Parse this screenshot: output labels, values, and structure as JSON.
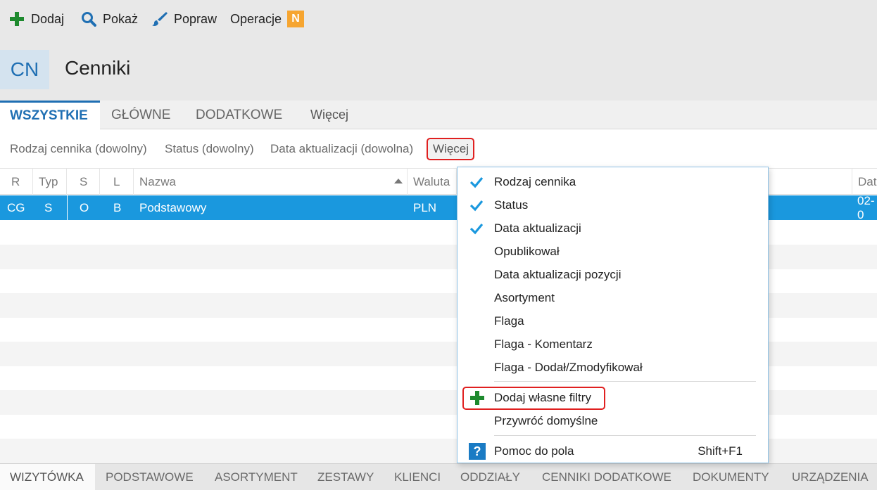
{
  "toolbar": {
    "add_label": "Dodaj",
    "show_label": "Pokaż",
    "edit_label": "Popraw",
    "operations_label": "Operacje",
    "operations_badge": "N",
    "colors": {
      "add_icon": "#1e8a2e",
      "search_icon": "#1f6fb3",
      "edit_icon": "#1f6fb3",
      "badge": "#f6a530"
    }
  },
  "header": {
    "code": "CN",
    "title": "Cenniki"
  },
  "tabs": [
    {
      "label": "WSZYSTKIE",
      "active": true
    },
    {
      "label": "GŁÓWNE"
    },
    {
      "label": "DODATKOWE"
    },
    {
      "label": "Więcej"
    }
  ],
  "filters": {
    "items": [
      "Rodzaj cennika (dowolny)",
      "Status (dowolny)",
      "Data aktualizacji (dowolna)"
    ],
    "more_label": "Więcej"
  },
  "grid": {
    "columns": [
      "R",
      "Typ",
      "S",
      "L",
      "Nazwa",
      "Waluta",
      "Dat"
    ],
    "rows": [
      {
        "r": "CG",
        "typ": "S",
        "s": "O",
        "l": "B",
        "nazwa": "Podstawowy",
        "waluta": "PLN",
        "data": "02-0",
        "selected": true
      }
    ]
  },
  "menu": {
    "items": [
      {
        "label": "Rodzaj cennika",
        "checked": true
      },
      {
        "label": "Status",
        "checked": true
      },
      {
        "label": "Data aktualizacji",
        "checked": true
      },
      {
        "label": "Opublikował",
        "checked": false
      },
      {
        "label": "Data aktualizacji pozycji",
        "checked": false
      },
      {
        "label": "Asortyment",
        "checked": false
      },
      {
        "label": "Flaga",
        "checked": false
      },
      {
        "label": "Flaga - Komentarz",
        "checked": false
      },
      {
        "label": "Flaga - Dodał/Zmodyfikował",
        "checked": false
      }
    ],
    "add_custom": "Dodaj własne filtry",
    "restore_defaults": "Przywróć domyślne",
    "help": "Pomoc do pola",
    "help_icon": "?",
    "help_shortcut": "Shift+F1",
    "colors": {
      "check": "#1a98de",
      "add": "#1e8a2e",
      "highlight": "#e02020"
    }
  },
  "bottom_tabs": [
    "WIZYTÓWKA",
    "PODSTAWOWE",
    "ASORTYMENT",
    "ZESTAWY",
    "KLIENCI",
    "ODDZIAŁY",
    "CENNIKI DODATKOWE",
    "DOKUMENTY",
    "URZĄDZENIA"
  ]
}
